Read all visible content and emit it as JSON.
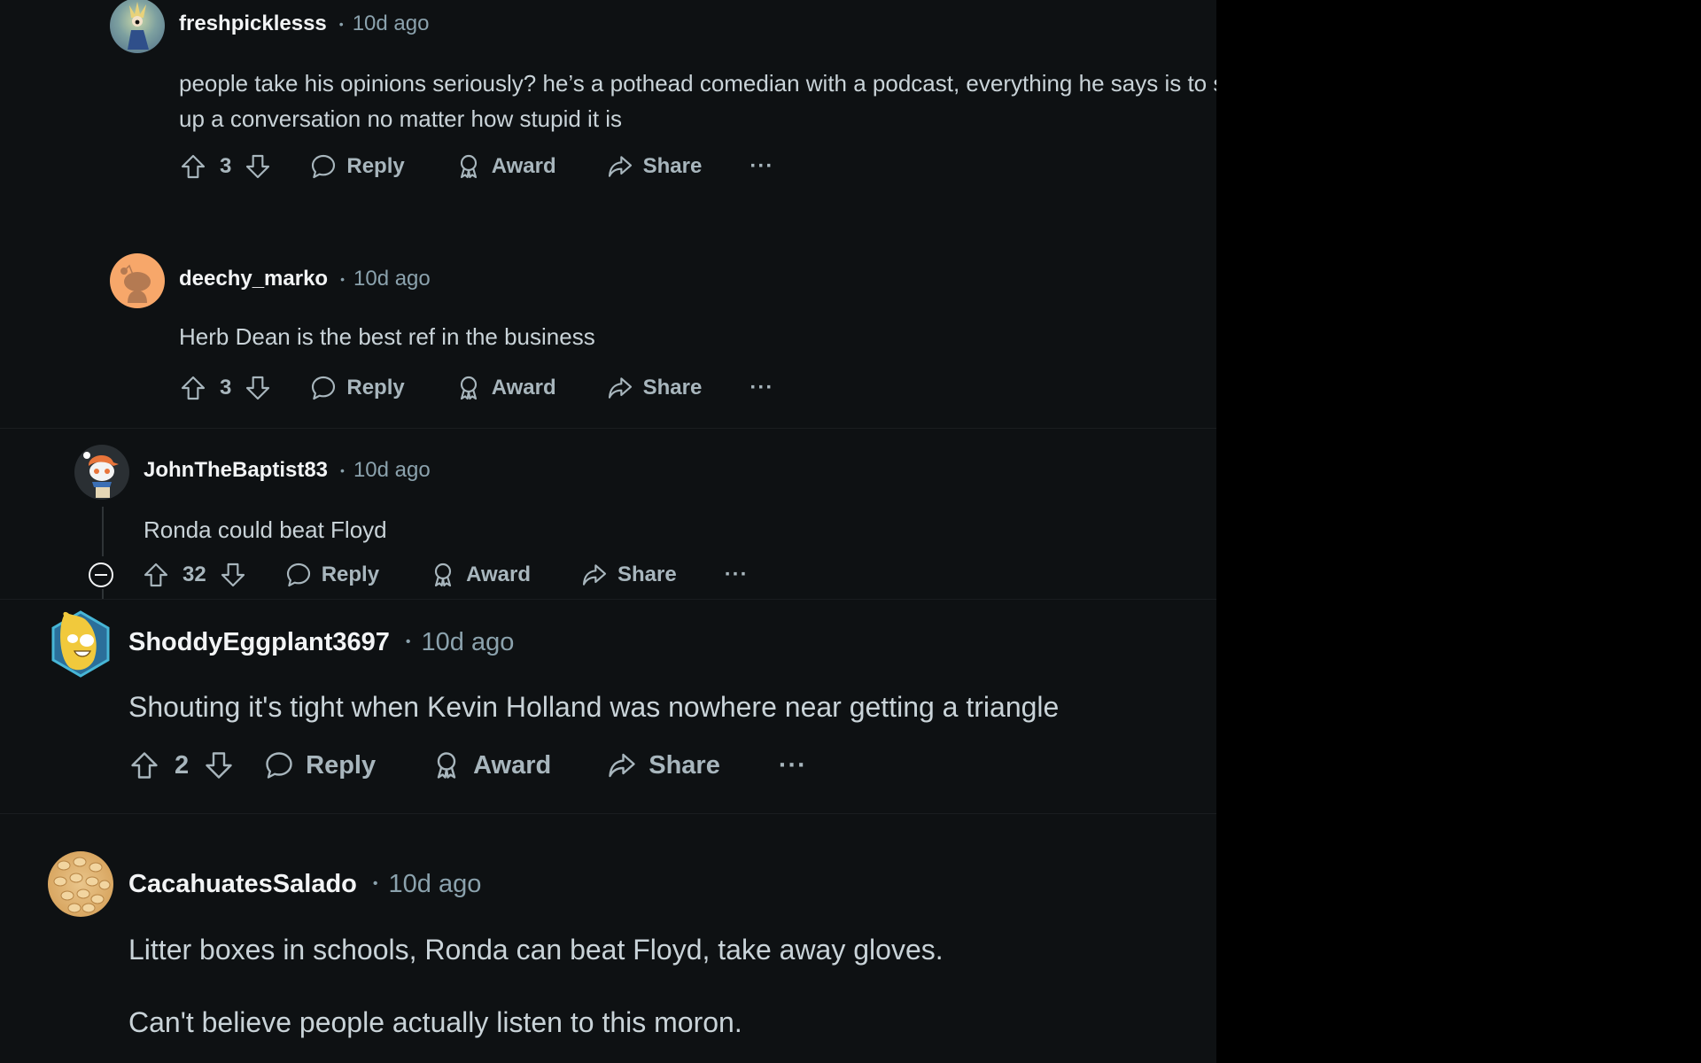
{
  "comments": [
    {
      "username": "freshpicklesss",
      "time": "10d ago",
      "avatar": "avatar-anime",
      "body_lines": [
        "people take his opinions seriously? he’s a pothead comedian with a podcast, everything he says is to stir",
        "up a conversation no matter how stupid it is"
      ],
      "score": "3",
      "reply": "Reply",
      "award": "Award",
      "share": "Share",
      "more": "···"
    },
    {
      "username": "deechy_marko",
      "time": "10d ago",
      "avatar": "avatar-default-orange",
      "body_lines": [
        "Herb Dean is the best ref in the business"
      ],
      "score": "3",
      "reply": "Reply",
      "award": "Award",
      "share": "Share",
      "more": "···"
    },
    {
      "username": "JohnTheBaptist83",
      "time": "10d ago",
      "avatar": "avatar-snoo-hat",
      "body_lines": [
        "Ronda could beat Floyd"
      ],
      "score": "32",
      "reply": "Reply",
      "award": "Award",
      "share": "Share",
      "more": "···"
    },
    {
      "username": "ShoddyEggplant3697",
      "time": "10d ago",
      "avatar": "avatar-banana-nft",
      "body_lines": [
        "Shouting it's tight when Kevin Holland was nowhere near getting a triangle"
      ],
      "score": "2",
      "reply": "Reply",
      "award": "Award",
      "share": "Share",
      "more": "···"
    },
    {
      "username": "CacahuatesSalado",
      "time": "10d ago",
      "avatar": "avatar-peanuts",
      "body_lines": [
        "Litter boxes in schools, Ronda can beat Floyd, take away gloves.",
        "Can't believe people actually listen to this moron."
      ]
    }
  ],
  "separator_dot": "•",
  "colors": {
    "panel_bg": "#0e1113",
    "outer_bg": "#000000",
    "username": "#f2f4f5",
    "meta": "#8ba2ad",
    "body": "#c9d3d8",
    "actions": "#a8b6bd"
  }
}
